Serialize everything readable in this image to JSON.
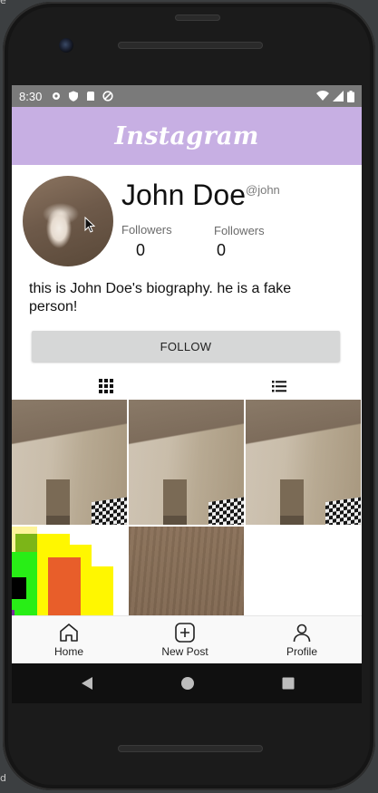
{
  "status_bar": {
    "time": "8:30"
  },
  "app_bar": {
    "title": "Instagram"
  },
  "profile": {
    "name": "John Doe",
    "handle": "@john",
    "stats": [
      {
        "label": "Followers",
        "value": "0"
      },
      {
        "label": "Followers",
        "value": "0"
      }
    ],
    "bio": "this is John Doe's biography. he is a fake person!",
    "follow_label": "FOLLOW"
  },
  "tabs": [
    {
      "icon": "grid-icon",
      "active": true
    },
    {
      "icon": "list-icon",
      "active": false
    }
  ],
  "bottom_nav": {
    "items": [
      {
        "label": "Home",
        "icon": "home-icon"
      },
      {
        "label": "New Post",
        "icon": "add-square-icon"
      },
      {
        "label": "Profile",
        "icon": "person-icon"
      }
    ]
  },
  "colors": {
    "app_bar": "#c7afe3",
    "follow_button": "#d6d7d7"
  }
}
